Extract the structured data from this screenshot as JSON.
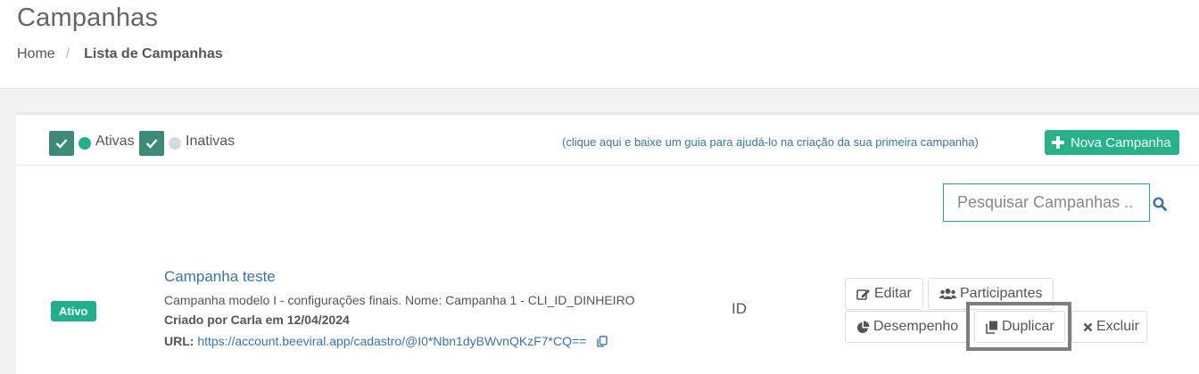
{
  "header": {
    "title": "Campanhas",
    "breadcrumb": {
      "home": "Home",
      "separator": "/",
      "current": "Lista de Campanhas"
    }
  },
  "filters": {
    "active": {
      "label": "Ativas",
      "checked": true,
      "dot_color": "#1fb08c"
    },
    "inactive": {
      "label": "Inativas",
      "checked": true,
      "dot_color": "#d5dbe0"
    }
  },
  "guide_link": "(clique aqui e baixe um guia para ajudá-lo na criação da sua primeira campanha)",
  "new_campaign_label": "Nova Campanha",
  "search": {
    "placeholder": "Pesquisar Campanhas ..",
    "value": ""
  },
  "campaign": {
    "status": "Ativo",
    "title": "Campanha teste",
    "description": "Campanha modelo I - configurações finais. Nome: Campanha 1 - CLI_ID_DINHEIRO",
    "created": "Criado por Carla em 12/04/2024",
    "url_label": "URL:",
    "url": "https://account.beeviral.app/cadastro/@I0*Nbn1dyBWvnQKzF7*CQ==",
    "id_label": "ID"
  },
  "actions": {
    "edit": "Editar",
    "participants": "Participantes",
    "performance": "Desempenho",
    "duplicate": "Duplicar",
    "delete": "Excluir"
  },
  "colors": {
    "accent": "#26b38b",
    "checkbox": "#3a8b78",
    "link": "#3b74a8"
  }
}
